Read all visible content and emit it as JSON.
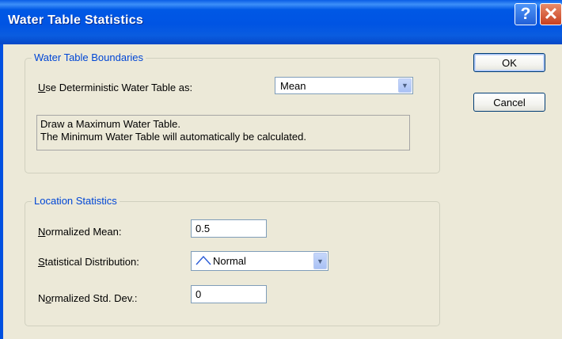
{
  "window": {
    "title": "Water Table Statistics",
    "help_glyph": "?",
    "close_glyph": "✕"
  },
  "boundaries": {
    "legend": "Water Table Boundaries",
    "use_label_mnemonic": "U",
    "use_label_rest": "se Deterministic Water Table as:",
    "use_value": "Mean",
    "info_line1": "Draw a Maximum Water Table.",
    "info_line2": "The Minimum Water Table will automatically be calculated."
  },
  "location": {
    "legend": "Location Statistics",
    "mean_label_mnemonic": "N",
    "mean_label_rest": "ormalized Mean:",
    "mean_value": "0.5",
    "dist_label_mnemonic": "S",
    "dist_label_rest": "tatistical Distribution:",
    "dist_value": "Normal",
    "std_label_prefix": "N",
    "std_label_mnemonic": "o",
    "std_label_rest": "rmalized Std. Dev.:",
    "std_value": "0"
  },
  "buttons": {
    "ok": "OK",
    "cancel": "Cancel"
  },
  "icons": {
    "help": "help-icon",
    "close": "close-icon",
    "dropdown": "chevron-down-icon",
    "distribution": "normal-curve-icon"
  },
  "colors": {
    "title_bar": "#0054E3",
    "dialog_bg": "#ECE9D8",
    "legend_text": "#0046D5"
  }
}
